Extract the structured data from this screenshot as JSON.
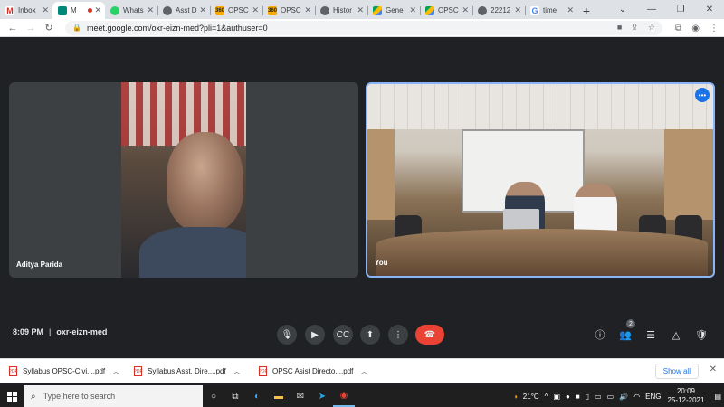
{
  "browser": {
    "tabs": [
      {
        "title": "Inbox",
        "icon": "gmail-icon",
        "fav": "M",
        "cls": "fav-gmail"
      },
      {
        "title": "M",
        "icon": "meet-icon",
        "fav": "",
        "cls": "fav-meet",
        "active": true,
        "recording": true
      },
      {
        "title": "Whats",
        "icon": "whatsapp-icon",
        "fav": "",
        "cls": "fav-whats"
      },
      {
        "title": "Asst D",
        "icon": "globe-icon",
        "fav": "",
        "cls": "fav-globe"
      },
      {
        "title": "OPSC",
        "icon": "360-icon",
        "fav": "360",
        "cls": "fav-360"
      },
      {
        "title": "OPSC",
        "icon": "360-icon",
        "fav": "360",
        "cls": "fav-360"
      },
      {
        "title": "Histor",
        "icon": "globe-icon",
        "fav": "",
        "cls": "fav-globe"
      },
      {
        "title": "Gene",
        "icon": "drive-icon",
        "fav": "",
        "cls": "fav-drive"
      },
      {
        "title": "OPSC",
        "icon": "drive-icon",
        "fav": "",
        "cls": "fav-drive"
      },
      {
        "title": "22212",
        "icon": "globe-icon",
        "fav": "",
        "cls": "fav-globe"
      },
      {
        "title": "time",
        "icon": "google-icon",
        "fav": "G",
        "cls": "fav-google"
      }
    ],
    "new_tab": "+",
    "url": "meet.google.com/oxr-eizn-med?pli=1&authuser=0"
  },
  "meet": {
    "participants": [
      {
        "name": "Aditya Parida"
      },
      {
        "name": "You"
      }
    ],
    "time": "8:09 PM",
    "separator": "|",
    "meeting_code": "oxr-eizn-med",
    "participant_count": "2"
  },
  "downloads": {
    "items": [
      {
        "name": "Syllabus OPSC-Civi....pdf"
      },
      {
        "name": "Syllabus Asst. Dire....pdf"
      },
      {
        "name": "OPSC Asist Directo....pdf"
      }
    ],
    "show_all": "Show all"
  },
  "taskbar": {
    "search_placeholder": "Type here to search",
    "temperature": "21°C",
    "language": "ENG",
    "time": "20:09",
    "date": "25-12-2021"
  },
  "colors": {
    "meet_bg": "#202124",
    "end_call": "#ea4335",
    "active_border": "#8ab4f8",
    "accent": "#1a73e8"
  }
}
